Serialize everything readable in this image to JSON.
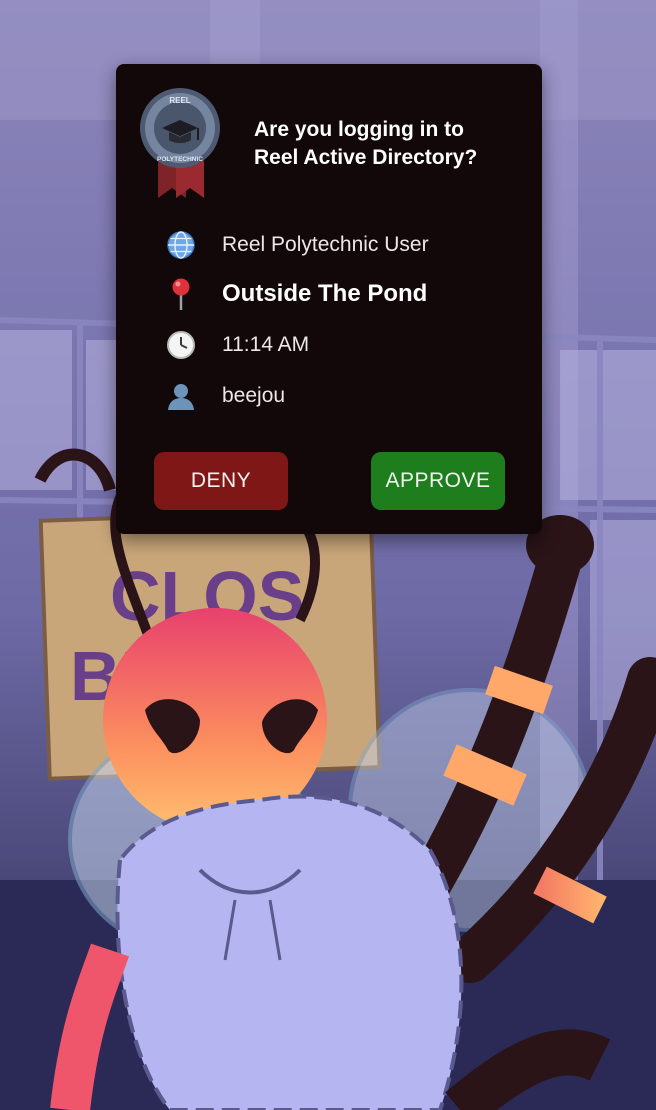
{
  "prompt": {
    "line1": "Are you logging in to",
    "line2": "Reel Active Directory?"
  },
  "details": [
    {
      "icon": "globe-icon",
      "text": "Reel Polytechnic User",
      "emphasis": false
    },
    {
      "icon": "location-pin-icon",
      "text": "Outside The Pond",
      "emphasis": true
    },
    {
      "icon": "clock-icon",
      "text": "11:14 AM",
      "emphasis": false
    },
    {
      "icon": "user-icon",
      "text": "beejou",
      "emphasis": false
    }
  ],
  "actions": {
    "deny_label": "DENY",
    "approve_label": "APPROVE"
  },
  "logo": {
    "text_top": "REEL",
    "text_bottom": "POLYTECHNIC"
  },
  "background": {
    "sign_text": [
      "CLOSED FOR",
      "BEE BARN"
    ]
  },
  "colors": {
    "dialog_bg": "#120709",
    "deny": "#7f1716",
    "approve": "#1e7d1c"
  }
}
